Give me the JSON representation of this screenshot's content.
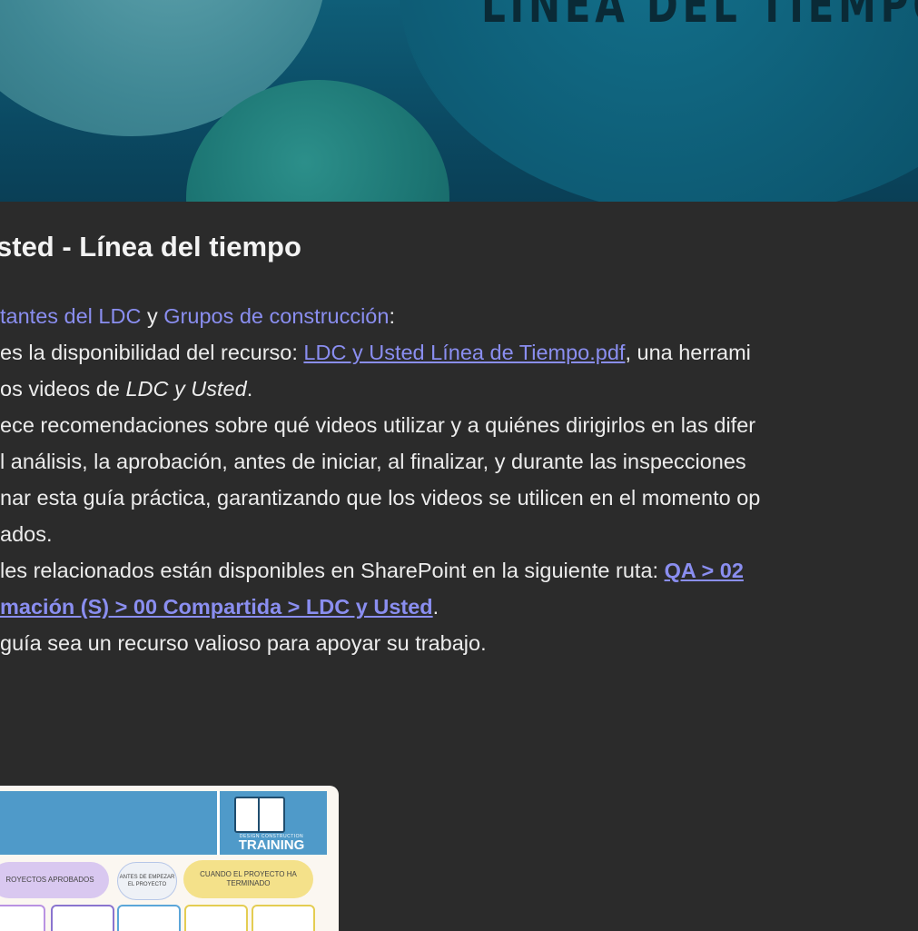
{
  "hero": {
    "title": "LÍNEA DEL TIEMPO"
  },
  "article": {
    "heading": "sted - Línea del tiempo",
    "intro": {
      "link1": "tantes del LDC",
      "conj": " y ",
      "link2": "Grupos de construcción",
      "colon": ":"
    },
    "l2": {
      "pre": "es la disponibilidad del recurso: ",
      "link": "LDC y Usted Línea de Tiempo.pdf",
      "post": ", una herrami"
    },
    "l3": {
      "pre": "os videos de ",
      "em": "LDC y Usted",
      "post": "."
    },
    "l4": "ece recomendaciones sobre qué videos utilizar y a quiénes dirigirlos en las difer",
    "l5": "l análisis, la aprobación, antes de iniciar, al finalizar, y durante las inspecciones",
    "l6": "nar esta guía práctica, garantizando que los videos se utilicen en el momento op",
    "l7": "ados.",
    "l8": {
      "pre": "les relacionados están disponibles en SharePoint en la siguiente ruta: ",
      "link": "QA > 02"
    },
    "l9": {
      "link": "mación (S) > 00 Compartida > LDC y Usted",
      "post": "."
    },
    "l10": "guía sea un recurso valioso para apoyar su trabajo."
  },
  "card": {
    "small_label": "DESIGN CONSTRUCTION",
    "big_label": "TRAINING",
    "pill1": "ROYECTOS APROBADOS",
    "pill2": "ANTES DE EMPEZAR EL PROYECTO",
    "pill3": "CUANDO EL PROYECTO HA TERMINADO"
  },
  "colors": {
    "link": "#8a8ef0",
    "background": "#2b2b2b"
  }
}
